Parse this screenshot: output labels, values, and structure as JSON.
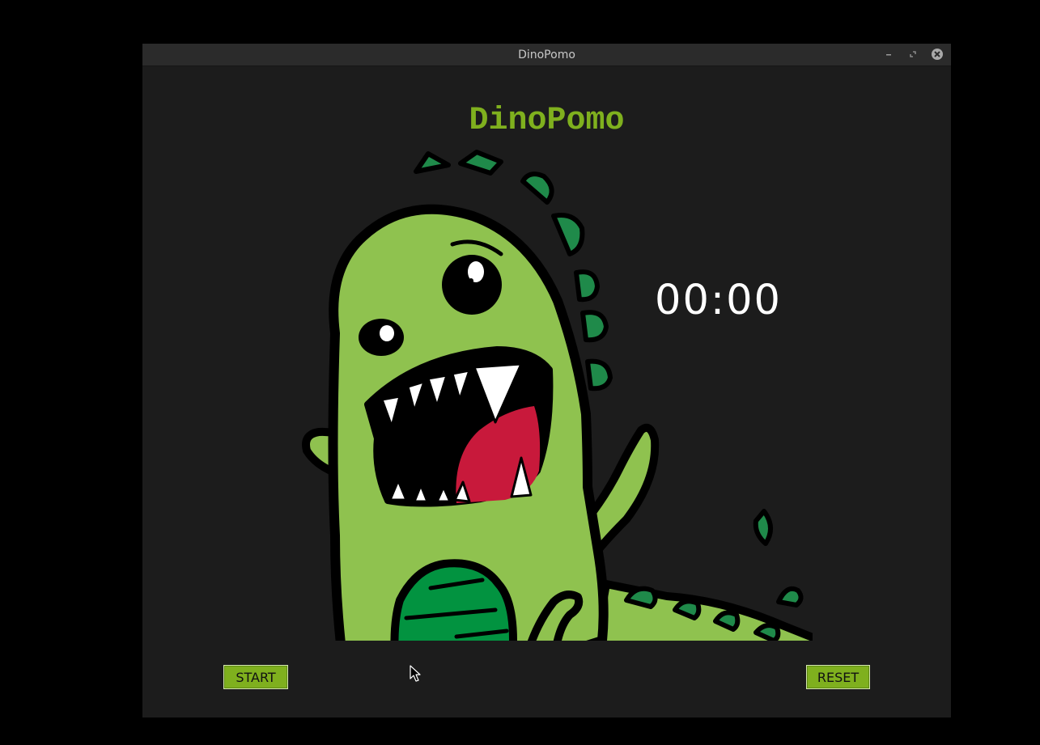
{
  "window": {
    "title": "DinoPomo",
    "controls": {
      "minimize_icon": "minimize-icon",
      "maximize_icon": "maximize-icon",
      "close_icon": "close-icon"
    }
  },
  "app": {
    "heading": "DinoPomo",
    "heading_color": "#7fb01e",
    "timer": "00:00",
    "mascot": "dinosaur-illustration"
  },
  "buttons": {
    "start_label": "START",
    "reset_label": "RESET",
    "accent": "#7fb01e"
  },
  "colors": {
    "background": "#1c1c1c",
    "body_green": "#8fc24f",
    "dark_green": "#1f8a4a",
    "belly_green": "#029340",
    "tongue": "#c8193b"
  }
}
